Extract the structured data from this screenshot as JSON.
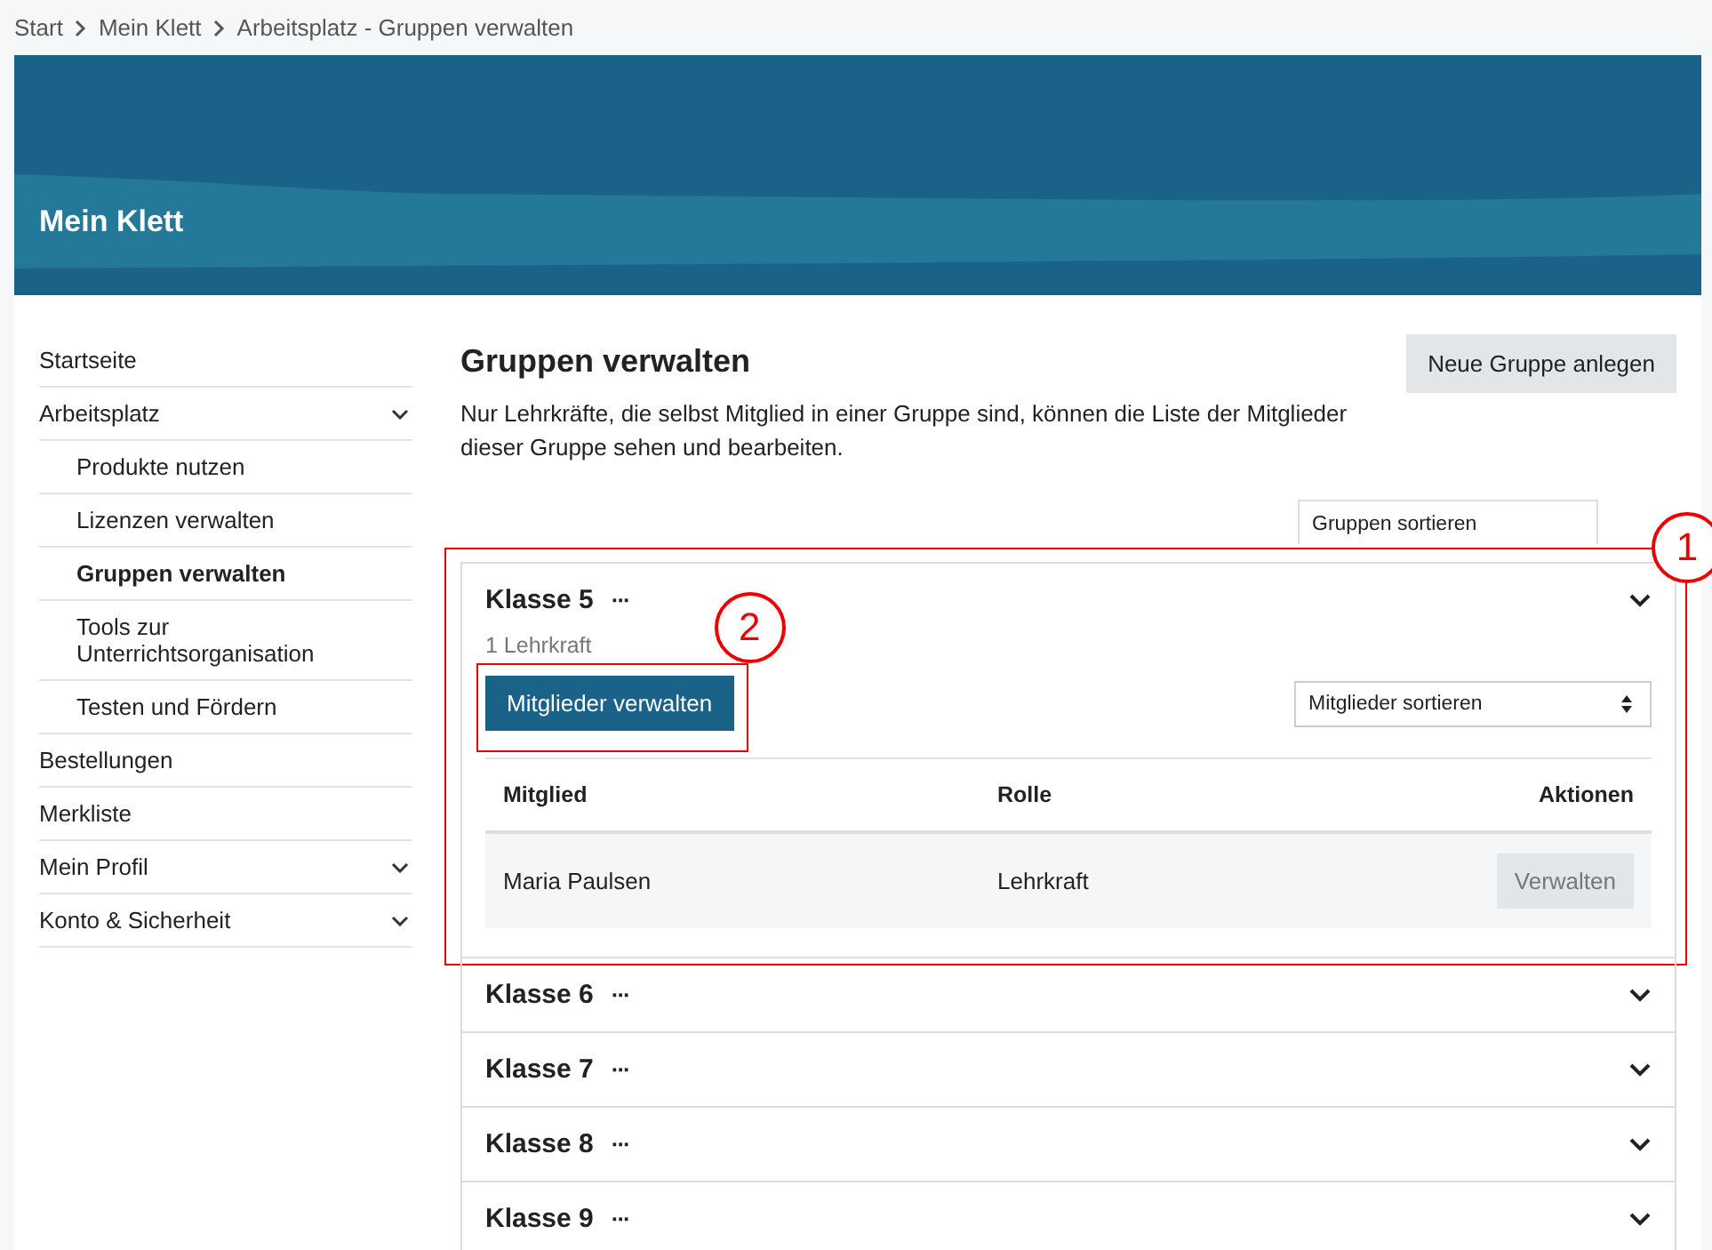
{
  "breadcrumb": [
    "Start",
    "Mein Klett",
    "Arbeitsplatz - Gruppen verwalten"
  ],
  "banner": {
    "title": "Mein Klett"
  },
  "sidebar": {
    "items": [
      {
        "label": "Startseite",
        "selected": false,
        "expandable": false
      },
      {
        "label": "Arbeitsplatz",
        "selected": false,
        "expandable": true,
        "children": [
          {
            "label": "Produkte nutzen",
            "selected": false
          },
          {
            "label": "Lizenzen verwalten",
            "selected": false
          },
          {
            "label": "Gruppen verwalten",
            "selected": true
          },
          {
            "label": "Tools zur Unterrichtsorganisation",
            "selected": false
          },
          {
            "label": "Testen und Fördern",
            "selected": false
          }
        ]
      },
      {
        "label": "Bestellungen",
        "selected": false,
        "expandable": false
      },
      {
        "label": "Merkliste",
        "selected": false,
        "expandable": false
      },
      {
        "label": "Mein Profil",
        "selected": false,
        "expandable": true
      },
      {
        "label": "Konto & Sicherheit",
        "selected": false,
        "expandable": true
      }
    ]
  },
  "page": {
    "title": "Gruppen verwalten",
    "description": "Nur Lehrkräfte, die selbst Mitglied in einer Gruppe sind, können die Liste der Mitglieder dieser Gruppe sehen und bearbeiten.",
    "new_group_button": "Neue Gruppe anlegen",
    "sort_groups": {
      "value": "Gruppen sortieren"
    }
  },
  "groups": [
    {
      "name": "Klasse 5",
      "more": "···",
      "expanded": true,
      "callout": "1",
      "count": "1 Lehrkraft",
      "manage_button": {
        "label": "Mitglieder verwalten",
        "callout": "2"
      },
      "sort_members": {
        "value": "Mitglieder sortieren"
      },
      "table": {
        "columns": [
          "Mitglied",
          "Rolle",
          "Aktionen"
        ],
        "rows": [
          {
            "member": "Maria Paulsen",
            "role": "Lehrkraft",
            "action": {
              "label": "Verwalten",
              "disabled": true
            }
          }
        ]
      }
    },
    {
      "name": "Klasse 6",
      "more": "···",
      "expanded": false
    },
    {
      "name": "Klasse 7",
      "more": "···",
      "expanded": false
    },
    {
      "name": "Klasse 8",
      "more": "···",
      "expanded": false
    },
    {
      "name": "Klasse 9",
      "more": "···",
      "expanded": false
    }
  ]
}
